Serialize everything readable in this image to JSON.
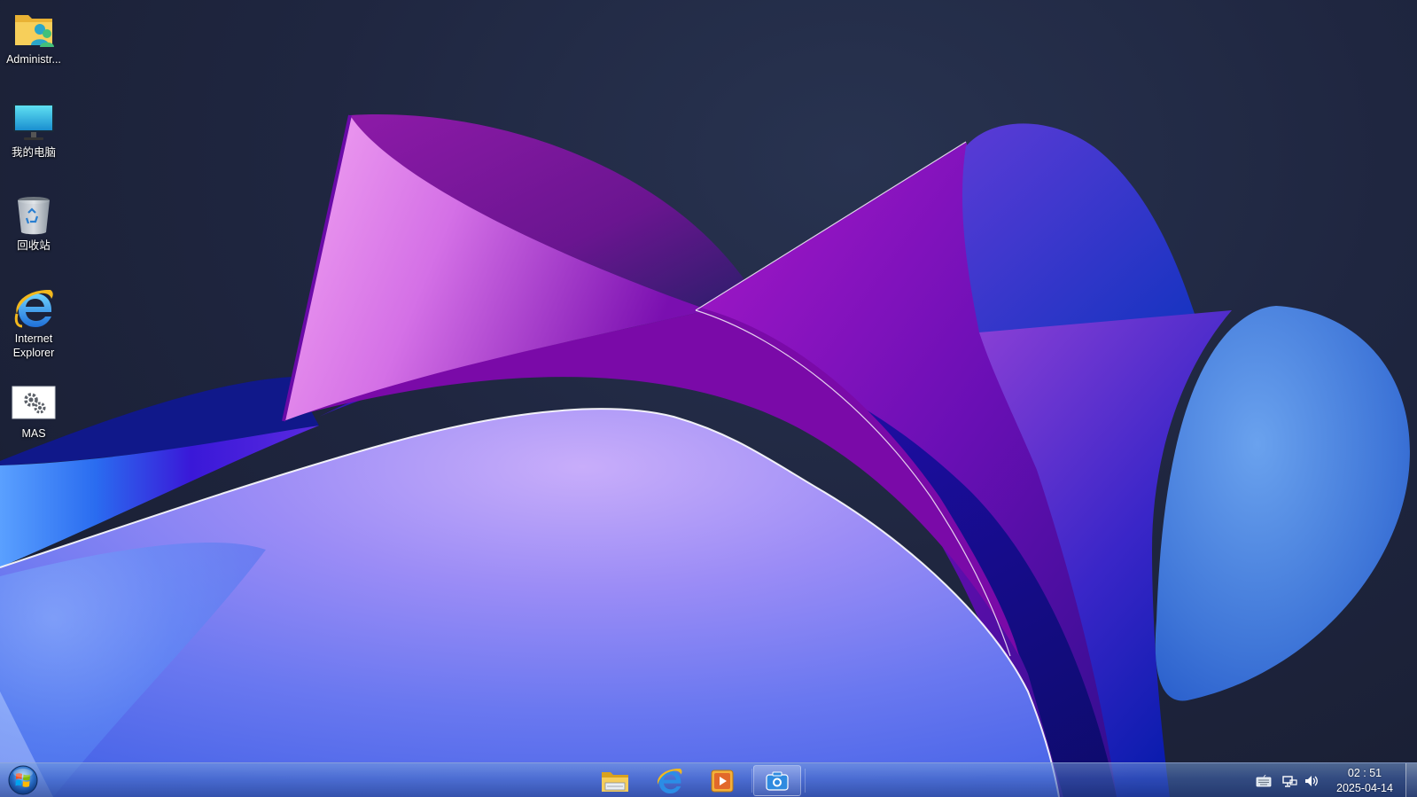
{
  "desktop": {
    "icons": [
      {
        "label": "Administr...",
        "icon": "user-folder-icon"
      },
      {
        "label": "我的电脑",
        "icon": "computer-monitor-icon"
      },
      {
        "label": "回收站",
        "icon": "recycle-bin-icon"
      },
      {
        "label": "Internet Explorer",
        "icon": "internet-explorer-icon"
      },
      {
        "label": "MAS",
        "icon": "settings-gears-icon"
      }
    ]
  },
  "taskbar": {
    "start_icon": "windows-start-orb-icon",
    "pinned": [
      {
        "icon": "file-explorer-icon"
      },
      {
        "icon": "internet-explorer-icon"
      },
      {
        "icon": "media-player-icon"
      },
      {
        "icon": "camera-screenshot-icon",
        "active": true
      }
    ],
    "tray": [
      {
        "icon": "keyboard-icon"
      },
      {
        "icon": "network-icon"
      },
      {
        "icon": "volume-icon"
      }
    ],
    "clock": {
      "time": "02 : 51",
      "date": "2025-04-14"
    }
  },
  "colors": {
    "background": "#1f2640",
    "taskbar": "#4a6fb8",
    "accent_purple": "#8a17c9",
    "accent_blue": "#3a56e0"
  }
}
